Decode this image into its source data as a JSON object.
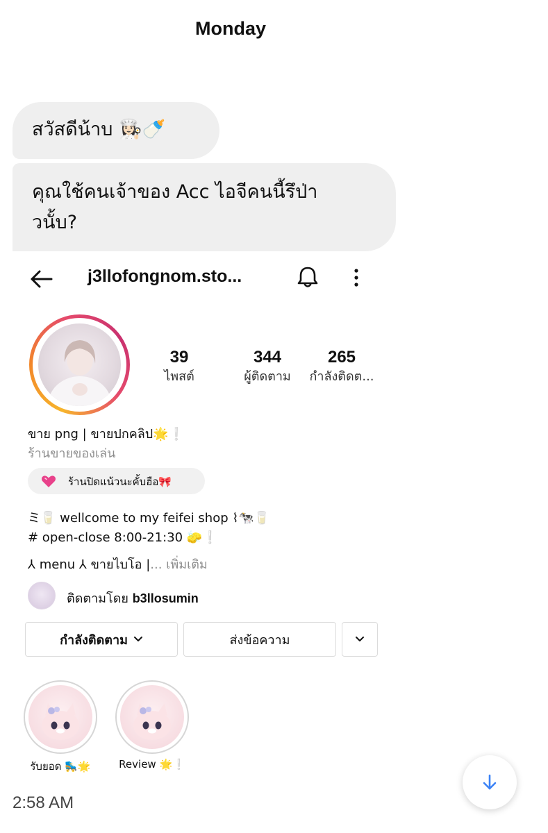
{
  "chat": {
    "day_label": "Monday",
    "messages": [
      {
        "text": "สวัสดีน้าบ 👩🏻‍🍳🍼"
      },
      {
        "line1": "คุณใช้คนเจ้าของ Acc ไอจีคนนี้รึป่า",
        "line2": "วนั้บ?"
      }
    ],
    "timestamp": "2:58 AM"
  },
  "profile": {
    "username": "j3llofongnom.sto...",
    "stats": {
      "posts_value": "39",
      "posts_label": "ไพสต์",
      "followers_value": "344",
      "followers_label": "ผู้ติดตาม",
      "following_value": "265",
      "following_label": "กำลังติดต..."
    },
    "bio": {
      "name": "ขาย png | ขายปกคลิป🌟❕",
      "category": "ร้านขายของเล่น",
      "note": "ร้านปิดแน้วนะคั้บฮือ🎀",
      "line1": "ミ🥛 wellcome to my feifei shop ⌇🐄🥛",
      "line2": "# open-close 8:00-21:30 🧽❕",
      "line3_text": "⅄ menu ⅄ ขายไบโอ |",
      "more_link": "... เพิ่มเติม",
      "followed_prefix": "ติดตามโดย",
      "followed_by": "b3llosumin"
    },
    "buttons": {
      "following": "กำลังติดตาม",
      "message": "ส่งข้อความ"
    },
    "highlights": [
      {
        "label": "รับยอด 🛼🌟"
      },
      {
        "label": "Review 🌟❕"
      }
    ]
  },
  "icons": {
    "back": "arrow-left-icon",
    "notifications": "bell-icon",
    "more": "more-vertical-icon",
    "scroll_down": "arrow-down-icon"
  },
  "colors": {
    "bubble_bg": "#efefef",
    "link_blue": "#3b82f6",
    "story_ring_start": "#f7b52c",
    "story_ring_end": "#c9316f"
  }
}
